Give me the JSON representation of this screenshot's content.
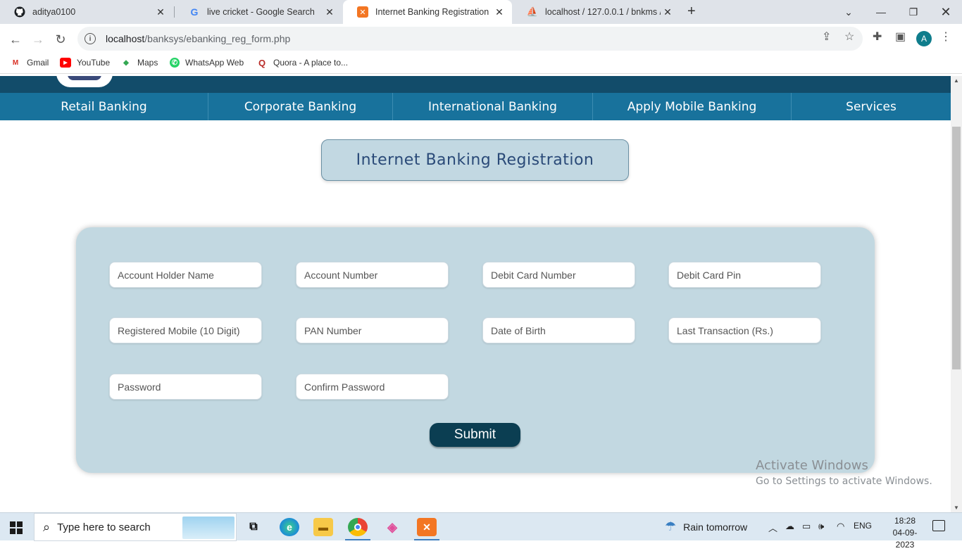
{
  "browser": {
    "tabs": [
      {
        "title": "aditya0100",
        "icon": "github-icon",
        "active": false
      },
      {
        "title": "live cricket - Google Search",
        "icon": "google-icon",
        "active": false
      },
      {
        "title": "Internet Banking Registration",
        "icon": "xampp-icon",
        "active": true
      },
      {
        "title": "localhost / 127.0.0.1 / bnkms / ba",
        "icon": "phpmyadmin-icon",
        "active": false
      }
    ],
    "url_host": "localhost",
    "url_path": "/banksys/ebanking_reg_form.php",
    "profile_initial": "A",
    "bookmarks": [
      {
        "label": "Gmail",
        "icon": "gmail-icon"
      },
      {
        "label": "YouTube",
        "icon": "youtube-icon"
      },
      {
        "label": "Maps",
        "icon": "maps-icon"
      },
      {
        "label": "WhatsApp Web",
        "icon": "whatsapp-icon"
      },
      {
        "label": "Quora - A place to...",
        "icon": "quora-icon"
      }
    ]
  },
  "site": {
    "nav": [
      "Retail Banking",
      "Corporate Banking",
      "International Banking",
      "Apply Mobile Banking",
      "Services"
    ],
    "page_title": "Internet Banking Registration",
    "fields": {
      "account_holder_name": "Account Holder Name",
      "account_number": "Account Number",
      "debit_card_number": "Debit Card Number",
      "debit_card_pin": "Debit Card Pin",
      "registered_mobile": "Registered Mobile (10 Digit)",
      "pan_number": "PAN Number",
      "date_of_birth": "Date of Birth",
      "last_transaction": "Last Transaction (Rs.)",
      "password": "Password",
      "confirm_password": "Confirm Password"
    },
    "submit_label": "Submit"
  },
  "watermark": {
    "line1": "Activate Windows",
    "line2": "Go to Settings to activate Windows."
  },
  "taskbar": {
    "search_placeholder": "Type here to search",
    "weather": "Rain tomorrow",
    "language": "ENG",
    "time": "18:28",
    "date": "04-09-2023"
  }
}
